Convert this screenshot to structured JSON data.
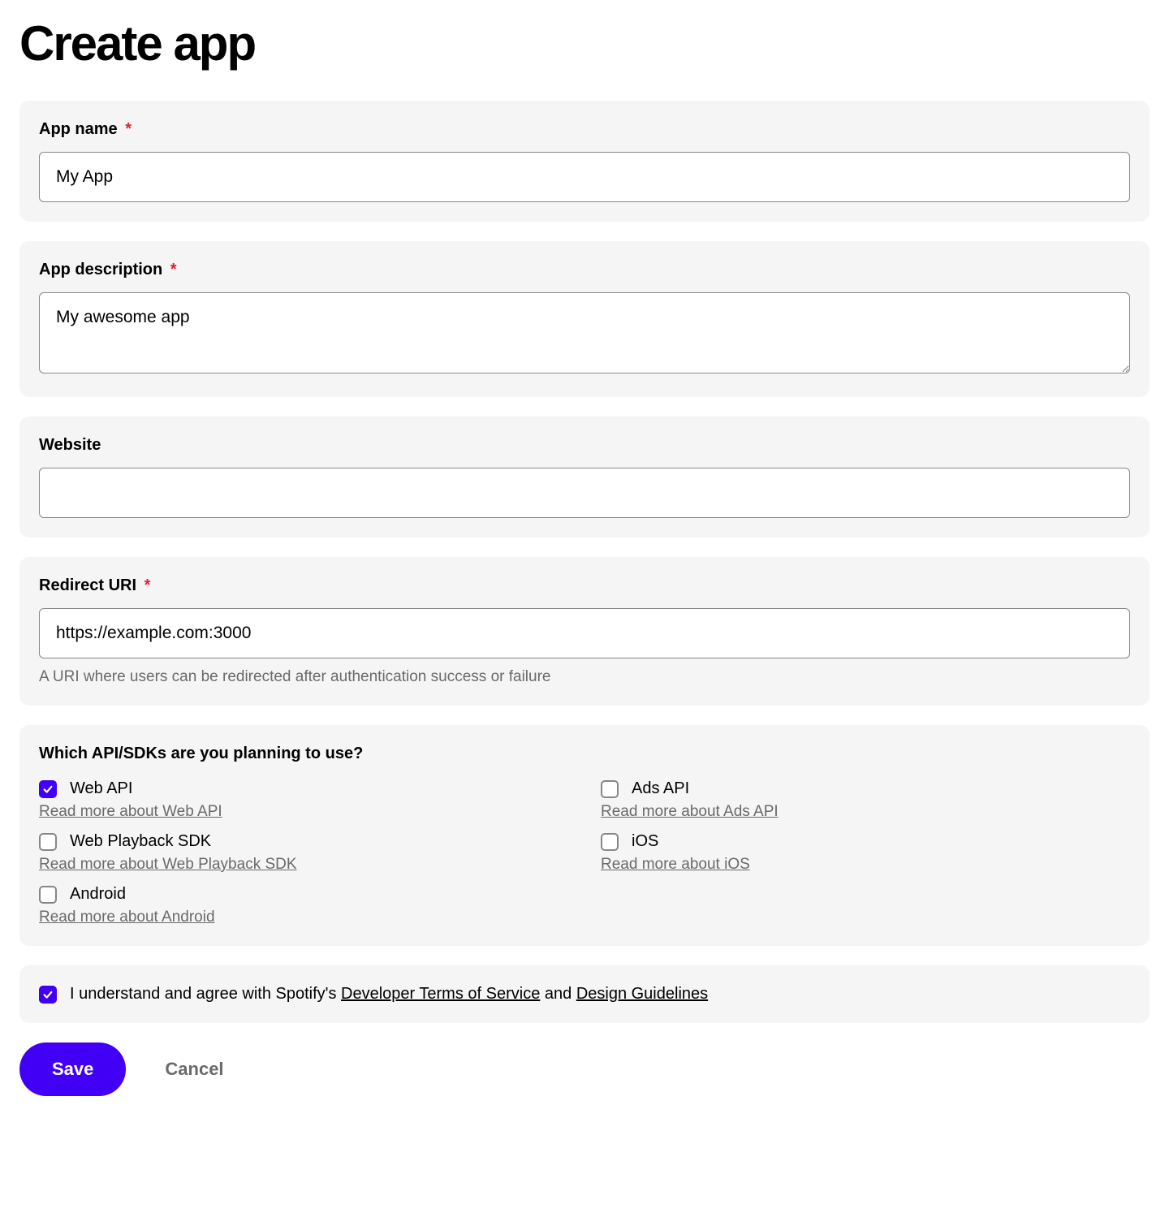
{
  "page_title": "Create app",
  "fields": {
    "app_name": {
      "label": "App name",
      "required": true,
      "value": "My App"
    },
    "app_description": {
      "label": "App description",
      "required": true,
      "value": "My awesome app"
    },
    "website": {
      "label": "Website",
      "required": false,
      "value": ""
    },
    "redirect_uri": {
      "label": "Redirect URI",
      "required": true,
      "value": "https://example.com:3000",
      "helper": "A URI where users can be redirected after authentication success or failure"
    }
  },
  "api_section": {
    "label": "Which API/SDKs are you planning to use?",
    "options": [
      {
        "id": "web-api",
        "label": "Web API",
        "checked": true,
        "read_more": "Read more about Web API"
      },
      {
        "id": "ads-api",
        "label": "Ads API",
        "checked": false,
        "read_more": "Read more about Ads API"
      },
      {
        "id": "web-playback-sdk",
        "label": "Web Playback SDK",
        "checked": false,
        "read_more": "Read more about Web Playback SDK"
      },
      {
        "id": "ios",
        "label": "iOS",
        "checked": false,
        "read_more": "Read more about iOS"
      },
      {
        "id": "android",
        "label": "Android",
        "checked": false,
        "read_more": "Read more about Android"
      }
    ]
  },
  "agreement": {
    "checked": true,
    "prefix": "I understand and agree with Spotify's ",
    "link1": "Developer Terms of Service",
    "middle": " and ",
    "link2": "Design Guidelines"
  },
  "buttons": {
    "save": "Save",
    "cancel": "Cancel"
  },
  "required_marker": "*"
}
